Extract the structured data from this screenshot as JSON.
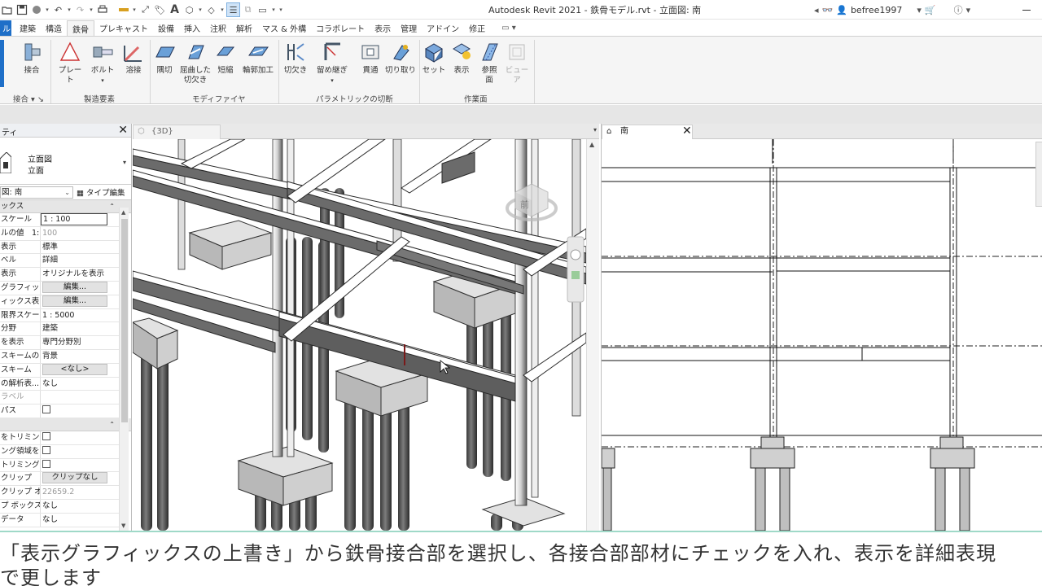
{
  "title_bar": {
    "app_title": "Autodesk Revit 2021 - 鉄骨モデル.rvt - 立面図: 南",
    "user": "befree1997",
    "help_icon": "help-icon",
    "cart_icon": "cart-icon"
  },
  "tabs": [
    {
      "label": "ル"
    },
    {
      "label": "建築"
    },
    {
      "label": "構造"
    },
    {
      "label": "鉄骨"
    },
    {
      "label": "プレキャスト"
    },
    {
      "label": "設備"
    },
    {
      "label": "挿入"
    },
    {
      "label": "注釈"
    },
    {
      "label": "解析"
    },
    {
      "label": "マス & 外構"
    },
    {
      "label": "コラボレート"
    },
    {
      "label": "表示"
    },
    {
      "label": "管理"
    },
    {
      "label": "アドイン"
    },
    {
      "label": "修正"
    }
  ],
  "ribbon": {
    "buttons": {
      "connection": "接合",
      "plate": "プレート",
      "bolt": "ボルト",
      "weld": "溶接",
      "corner_cut": "隅切",
      "cope_line1": "屈曲した",
      "cope_line2": "切欠き",
      "shorten": "短縮",
      "contour_cut": "輪郭加工",
      "notch": "切欠き",
      "miter_line1": "留め継ぎ",
      "cut_through": "貫通",
      "cut_by": "切り取り",
      "set": "セット",
      "show": "表示",
      "ref_plane_line1": "参照",
      "ref_plane_line2": "面",
      "viewer": "ビューア"
    },
    "panels": {
      "connection": "接合",
      "fabrication": "製造要素",
      "modifier": "モディファイヤ",
      "parametric_cut": "パラメトリックの切断",
      "work_plane": "作業面"
    }
  },
  "properties": {
    "header": "ティ",
    "type_line1": "立面図",
    "type_line2": "立面",
    "filter_value": "図: 南",
    "edit_type": "タイプ編集",
    "group_graphics": "ックス",
    "group_extents": "",
    "rows_graphics": [
      {
        "name": "スケール",
        "value": "1 : 100",
        "kind": "input"
      },
      {
        "name": "ルの値　1:",
        "value": "100",
        "kind": "grey"
      },
      {
        "name": "表示",
        "value": "標準",
        "kind": "text"
      },
      {
        "name": "ベル",
        "value": "詳細",
        "kind": "text"
      },
      {
        "name": "表示",
        "value": "オリジナルを表示",
        "kind": "text"
      },
      {
        "name": "グラフィッ...",
        "value": "編集...",
        "kind": "button"
      },
      {
        "name": "ィックス表...",
        "value": "編集...",
        "kind": "button"
      },
      {
        "name": "限界スケール",
        "value": "1 : 5000",
        "kind": "text"
      },
      {
        "name": "分野",
        "value": "建築",
        "kind": "text"
      },
      {
        "name": "を表示",
        "value": "専門分野別",
        "kind": "text"
      },
      {
        "name": "スキームの...",
        "value": "背景",
        "kind": "text"
      },
      {
        "name": "スキーム",
        "value": "<なし>",
        "kind": "button"
      },
      {
        "name": "の解析表...",
        "value": "なし",
        "kind": "text"
      },
      {
        "name": "ラベル",
        "value": "",
        "kind": "grey-name"
      },
      {
        "name": "パス",
        "value": "",
        "kind": "checkbox"
      }
    ],
    "rows_extents": [
      {
        "name": "をトリミング",
        "value": "",
        "kind": "checkbox"
      },
      {
        "name": "ング領域を...",
        "value": "",
        "kind": "checkbox"
      },
      {
        "name": "トリミング",
        "value": "",
        "kind": "checkbox"
      },
      {
        "name": "クリップ",
        "value": "クリップなし",
        "kind": "button"
      },
      {
        "name": "クリップ オ...",
        "value": "22659.2",
        "kind": "grey"
      },
      {
        "name": "プ ボックス",
        "value": "なし",
        "kind": "text"
      },
      {
        "name": "データ",
        "value": "なし",
        "kind": "text"
      }
    ]
  },
  "view_3d": {
    "tab_label": "{3D}",
    "viewcube_label": "前"
  },
  "view_south": {
    "tab_label": "南"
  },
  "subtitle": {
    "line1": "「表示グラフィックスの上書き」から鉄骨接合部を選択し、各接合部部材にチェックを入れ、表示を詳細表現",
    "line2": "で更します"
  },
  "colors": {
    "accent": "#1e6fc8",
    "steel_dark": "#6b6b6b",
    "steel_light": "#ffffff",
    "concrete": "#cfcfcf",
    "subtitle_border": "#9fd9c8"
  }
}
